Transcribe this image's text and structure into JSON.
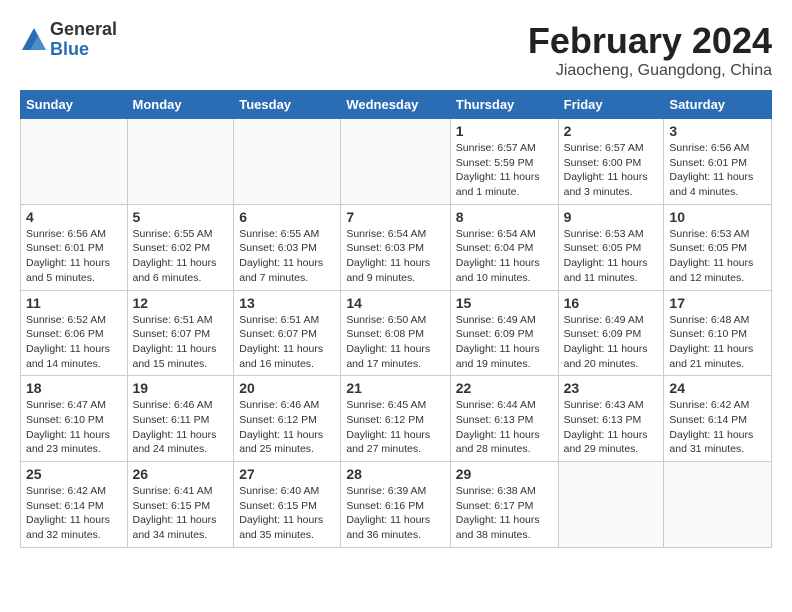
{
  "header": {
    "logo_line1": "General",
    "logo_line2": "Blue",
    "main_title": "February 2024",
    "sub_title": "Jiaocheng, Guangdong, China"
  },
  "days_of_week": [
    "Sunday",
    "Monday",
    "Tuesday",
    "Wednesday",
    "Thursday",
    "Friday",
    "Saturday"
  ],
  "weeks": [
    [
      {
        "day": "",
        "info": ""
      },
      {
        "day": "",
        "info": ""
      },
      {
        "day": "",
        "info": ""
      },
      {
        "day": "",
        "info": ""
      },
      {
        "day": "1",
        "info": "Sunrise: 6:57 AM\nSunset: 5:59 PM\nDaylight: 11 hours and 1 minute."
      },
      {
        "day": "2",
        "info": "Sunrise: 6:57 AM\nSunset: 6:00 PM\nDaylight: 11 hours and 3 minutes."
      },
      {
        "day": "3",
        "info": "Sunrise: 6:56 AM\nSunset: 6:01 PM\nDaylight: 11 hours and 4 minutes."
      }
    ],
    [
      {
        "day": "4",
        "info": "Sunrise: 6:56 AM\nSunset: 6:01 PM\nDaylight: 11 hours and 5 minutes."
      },
      {
        "day": "5",
        "info": "Sunrise: 6:55 AM\nSunset: 6:02 PM\nDaylight: 11 hours and 6 minutes."
      },
      {
        "day": "6",
        "info": "Sunrise: 6:55 AM\nSunset: 6:03 PM\nDaylight: 11 hours and 7 minutes."
      },
      {
        "day": "7",
        "info": "Sunrise: 6:54 AM\nSunset: 6:03 PM\nDaylight: 11 hours and 9 minutes."
      },
      {
        "day": "8",
        "info": "Sunrise: 6:54 AM\nSunset: 6:04 PM\nDaylight: 11 hours and 10 minutes."
      },
      {
        "day": "9",
        "info": "Sunrise: 6:53 AM\nSunset: 6:05 PM\nDaylight: 11 hours and 11 minutes."
      },
      {
        "day": "10",
        "info": "Sunrise: 6:53 AM\nSunset: 6:05 PM\nDaylight: 11 hours and 12 minutes."
      }
    ],
    [
      {
        "day": "11",
        "info": "Sunrise: 6:52 AM\nSunset: 6:06 PM\nDaylight: 11 hours and 14 minutes."
      },
      {
        "day": "12",
        "info": "Sunrise: 6:51 AM\nSunset: 6:07 PM\nDaylight: 11 hours and 15 minutes."
      },
      {
        "day": "13",
        "info": "Sunrise: 6:51 AM\nSunset: 6:07 PM\nDaylight: 11 hours and 16 minutes."
      },
      {
        "day": "14",
        "info": "Sunrise: 6:50 AM\nSunset: 6:08 PM\nDaylight: 11 hours and 17 minutes."
      },
      {
        "day": "15",
        "info": "Sunrise: 6:49 AM\nSunset: 6:09 PM\nDaylight: 11 hours and 19 minutes."
      },
      {
        "day": "16",
        "info": "Sunrise: 6:49 AM\nSunset: 6:09 PM\nDaylight: 11 hours and 20 minutes."
      },
      {
        "day": "17",
        "info": "Sunrise: 6:48 AM\nSunset: 6:10 PM\nDaylight: 11 hours and 21 minutes."
      }
    ],
    [
      {
        "day": "18",
        "info": "Sunrise: 6:47 AM\nSunset: 6:10 PM\nDaylight: 11 hours and 23 minutes."
      },
      {
        "day": "19",
        "info": "Sunrise: 6:46 AM\nSunset: 6:11 PM\nDaylight: 11 hours and 24 minutes."
      },
      {
        "day": "20",
        "info": "Sunrise: 6:46 AM\nSunset: 6:12 PM\nDaylight: 11 hours and 25 minutes."
      },
      {
        "day": "21",
        "info": "Sunrise: 6:45 AM\nSunset: 6:12 PM\nDaylight: 11 hours and 27 minutes."
      },
      {
        "day": "22",
        "info": "Sunrise: 6:44 AM\nSunset: 6:13 PM\nDaylight: 11 hours and 28 minutes."
      },
      {
        "day": "23",
        "info": "Sunrise: 6:43 AM\nSunset: 6:13 PM\nDaylight: 11 hours and 29 minutes."
      },
      {
        "day": "24",
        "info": "Sunrise: 6:42 AM\nSunset: 6:14 PM\nDaylight: 11 hours and 31 minutes."
      }
    ],
    [
      {
        "day": "25",
        "info": "Sunrise: 6:42 AM\nSunset: 6:14 PM\nDaylight: 11 hours and 32 minutes."
      },
      {
        "day": "26",
        "info": "Sunrise: 6:41 AM\nSunset: 6:15 PM\nDaylight: 11 hours and 34 minutes."
      },
      {
        "day": "27",
        "info": "Sunrise: 6:40 AM\nSunset: 6:15 PM\nDaylight: 11 hours and 35 minutes."
      },
      {
        "day": "28",
        "info": "Sunrise: 6:39 AM\nSunset: 6:16 PM\nDaylight: 11 hours and 36 minutes."
      },
      {
        "day": "29",
        "info": "Sunrise: 6:38 AM\nSunset: 6:17 PM\nDaylight: 11 hours and 38 minutes."
      },
      {
        "day": "",
        "info": ""
      },
      {
        "day": "",
        "info": ""
      }
    ]
  ]
}
